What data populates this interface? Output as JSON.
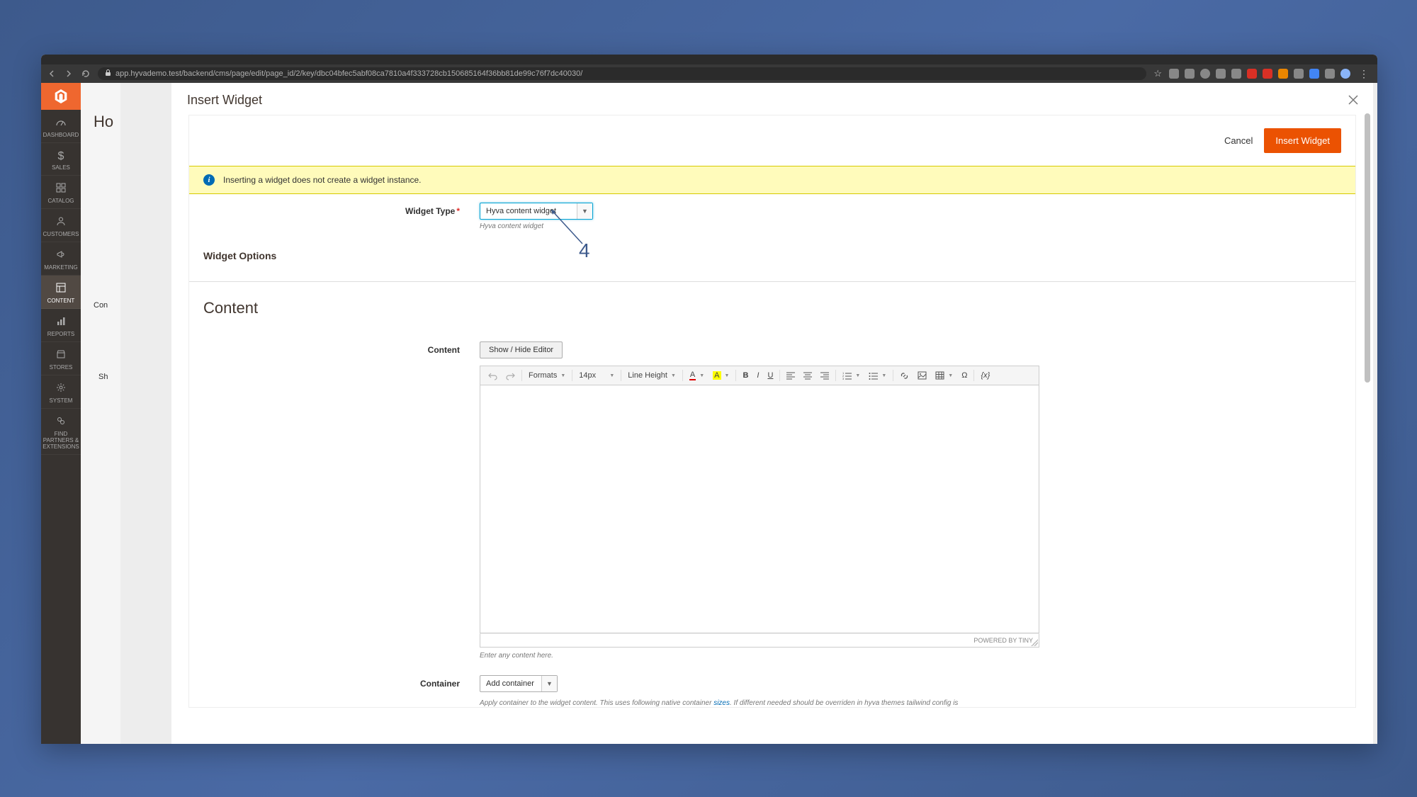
{
  "browser": {
    "url": "app.hyvademo.test/backend/cms/page/edit/page_id/2/key/dbc04bfec5abf08ca7810a4f333728cb150685164f36bb81de99c76f7dc40030/"
  },
  "sidebar": {
    "items": [
      {
        "label": "DASHBOARD",
        "icon": "dashboard"
      },
      {
        "label": "SALES",
        "icon": "dollar"
      },
      {
        "label": "CATALOG",
        "icon": "catalog"
      },
      {
        "label": "CUSTOMERS",
        "icon": "user"
      },
      {
        "label": "MARKETING",
        "icon": "megaphone"
      },
      {
        "label": "CONTENT",
        "icon": "content",
        "active": true
      },
      {
        "label": "REPORTS",
        "icon": "reports"
      },
      {
        "label": "STORES",
        "icon": "stores"
      },
      {
        "label": "SYSTEM",
        "icon": "gear"
      },
      {
        "label": "FIND PARTNERS & EXTENSIONS",
        "icon": "partners"
      }
    ]
  },
  "background": {
    "page_title": "Ho",
    "label_content": "Con",
    "label_sh": "Sh"
  },
  "modal": {
    "title": "Insert Widget",
    "actions": {
      "cancel": "Cancel",
      "insert": "Insert Widget"
    },
    "info": "Inserting a widget does not create a widget instance.",
    "widget_type": {
      "label": "Widget Type",
      "value": "Hyva content widget",
      "hint": "Hyva content widget"
    },
    "widget_options_heading": "Widget Options",
    "content_heading": "Content",
    "content_field": {
      "label": "Content",
      "show_hide": "Show / Hide Editor",
      "hint": "Enter any content here."
    },
    "editor": {
      "format_label": "Formats",
      "font_size": "14px",
      "line_height": "Line Height",
      "powered": "POWERED BY TINY"
    },
    "container_field": {
      "label": "Container",
      "value": "Add container",
      "hint_pre": "Apply container to the widget content. This uses following native container ",
      "hint_link": "sizes",
      "hint_post": ". If different needed should be overriden in hyva themes tailwind config is"
    },
    "annotation": "4"
  }
}
